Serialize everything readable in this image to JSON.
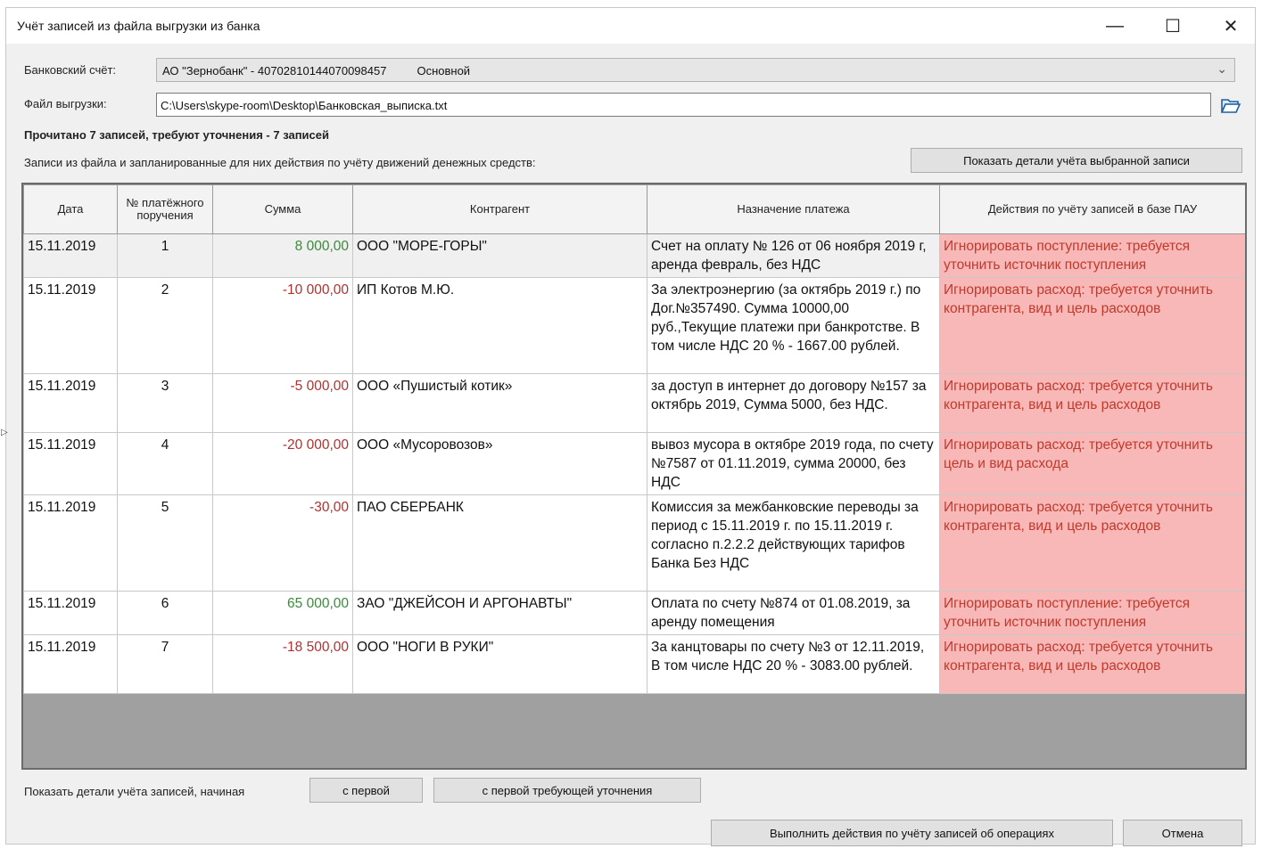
{
  "window": {
    "title": "Учёт записей из файла выгрузки из банка",
    "minimize": "—",
    "maximize": "☐",
    "close": "✕"
  },
  "form": {
    "account_label": "Банковский счёт:",
    "account_value": "АО \"Зернобанк\" - 40702810144070098457",
    "account_type": "Основной",
    "file_label": "Файл выгрузки:",
    "file_value": "C:\\Users\\skype-room\\Desktop\\Банковская_выписка.txt",
    "status_text": "Прочитано 7 записей, требуют уточнения - 7 записей",
    "records_label": "Записи из файла и запланированные для них действия по учёту движений денежных средств:",
    "details_button": "Показать детали учёта выбранной записи"
  },
  "table": {
    "columns": [
      "Дата",
      "№ платёжного поручения",
      "Сумма",
      "Контрагент",
      "Назначение платежа",
      "Действия по учёту записей в базе ПАУ"
    ],
    "rows": [
      {
        "date": "15.11.2019",
        "num": "1",
        "sum": "8 000,00",
        "sign": "pos",
        "party": "ООО \"МОРЕ-ГОРЫ\"",
        "purpose": "Счет на оплату № 126 от 06 ноября 2019 г, аренда февраль, без НДС",
        "action": "Игнорировать поступление: требуется уточнить источник поступления"
      },
      {
        "date": "15.11.2019",
        "num": "2",
        "sum": "-10 000,00",
        "sign": "neg",
        "party": "ИП Котов М.Ю.",
        "purpose": "За электроэнергию (за октябрь 2019 г.) по Дог.№357490. Сумма 10000,00 руб.,Текущие платежи при банкротстве. В том числе НДС 20 % - 1667.00 рублей.",
        "action": "Игнорировать расход: требуется уточнить контрагента, вид и цель расходов"
      },
      {
        "date": "15.11.2019",
        "num": "3",
        "sum": "-5 000,00",
        "sign": "neg",
        "party": "ООО «Пушистый котик»",
        "purpose": "за доступ в интернет до договору №157 за октябрь 2019, Сумма 5000, без НДС.",
        "action": "Игнорировать расход: требуется уточнить контрагента, вид и цель расходов"
      },
      {
        "date": "15.11.2019",
        "num": "4",
        "sum": "-20 000,00",
        "sign": "neg",
        "party": "ООО «Мусоровозов»",
        "purpose": "вывоз мусора в октябре 2019 года, по счету №7587 от 01.11.2019, сумма 20000, без НДС",
        "action": "Игнорировать расход: требуется уточнить цель и вид расхода"
      },
      {
        "date": "15.11.2019",
        "num": "5",
        "sum": "-30,00",
        "sign": "neg",
        "party": "ПАО СБЕРБАНК",
        "purpose": "Комиссия за межбанковские переводы за период с 15.11.2019 г. по 15.11.2019 г. согласно п.2.2.2 действующих тарифов Банка Без НДС",
        "action": "Игнорировать расход: требуется уточнить контрагента, вид и цель расходов"
      },
      {
        "date": "15.11.2019",
        "num": "6",
        "sum": "65 000,00",
        "sign": "pos",
        "party": "ЗАО \"ДЖЕЙСОН И АРГОНАВТЫ\"",
        "purpose": "Оплата по счету №874 от 01.08.2019, за аренду помещения",
        "action": "Игнорировать поступление: требуется уточнить источник поступления"
      },
      {
        "date": "15.11.2019",
        "num": "7",
        "sum": "-18 500,00",
        "sign": "neg",
        "party": "ООО \"НОГИ В РУКИ\"",
        "purpose": "За канцтовары по счету №3 от 12.11.2019, В том числе НДС 20 % - 3083.00 рублей.",
        "action": "Игнорировать расход: требуется уточнить контрагента, вид и цель расходов"
      }
    ]
  },
  "footer": {
    "show_details_label": "Показать детали учёта записей, начиная",
    "from_first_button": "с первой",
    "from_first_unclear_button": "с первой требующей уточнения",
    "execute_button": "Выполнить действия по учёту записей об операциях",
    "cancel_button": "Отмена"
  },
  "colors": {
    "action_bg": "#f8b8b8",
    "action_text": "#c0392b",
    "positive": "#3a8a3a",
    "negative": "#b03030"
  },
  "icons": {
    "folder": "folder-open-icon",
    "dropdown": "chevron-down-icon"
  }
}
